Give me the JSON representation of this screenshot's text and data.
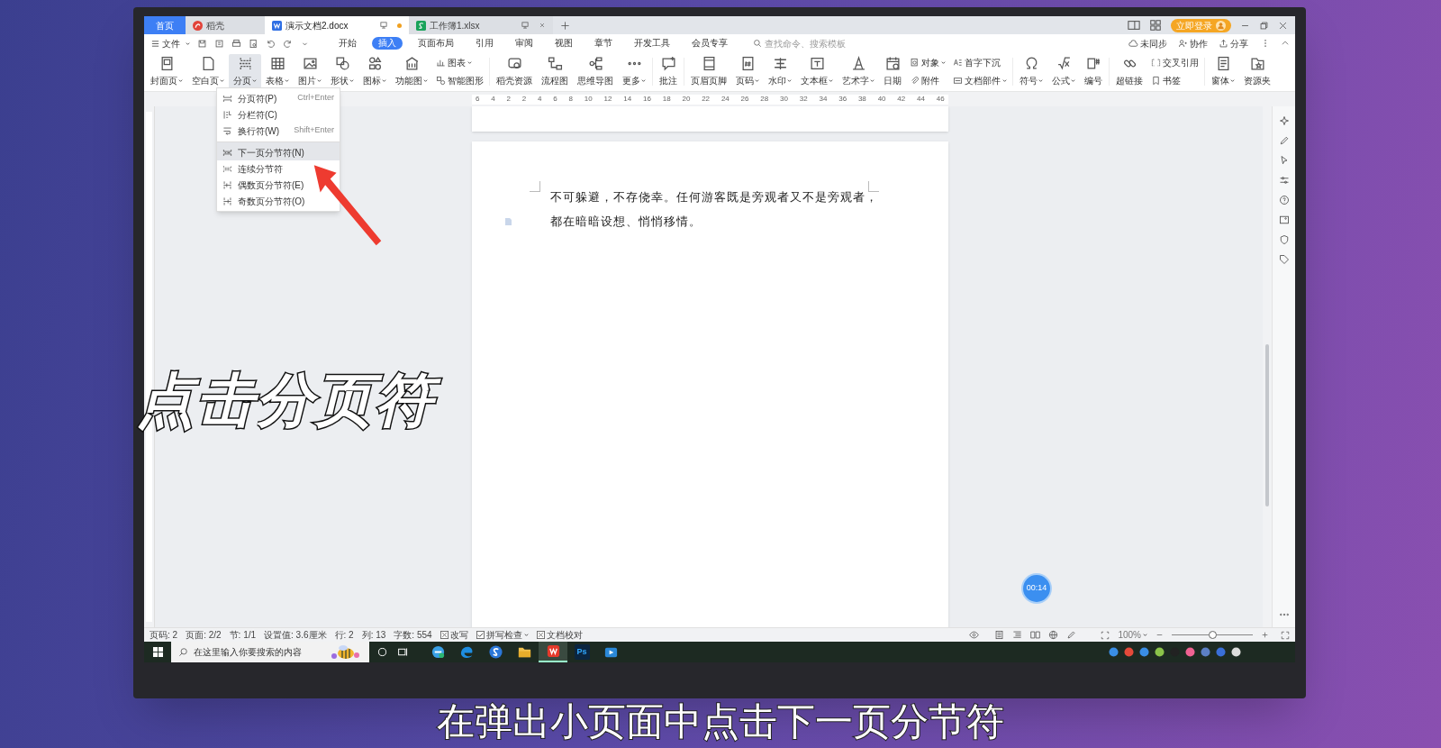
{
  "tabs": [
    {
      "label": "首页",
      "kind": "home",
      "selected": false
    },
    {
      "label": "稻壳",
      "kind": "daoke",
      "selected": false
    },
    {
      "label": "演示文档2.docx",
      "kind": "doc",
      "selected": true
    },
    {
      "label": "工作簿1.xlsx",
      "kind": "sheet",
      "selected": false
    }
  ],
  "login": "立即登录",
  "menu": {
    "file": "文件",
    "tabs": [
      {
        "label": "开始",
        "selected": false
      },
      {
        "label": "插入",
        "selected": true
      },
      {
        "label": "页面布局",
        "selected": false
      },
      {
        "label": "引用",
        "selected": false
      },
      {
        "label": "审阅",
        "selected": false
      },
      {
        "label": "视图",
        "selected": false
      },
      {
        "label": "章节",
        "selected": false
      },
      {
        "label": "开发工具",
        "selected": false
      },
      {
        "label": "会员专享",
        "selected": false
      }
    ],
    "search": {
      "placeholder": "查找命令、搜索模板"
    },
    "right": [
      "未同步",
      "协作",
      "分享"
    ]
  },
  "ribbon": [
    {
      "kind": "big",
      "label": "封面页",
      "dropdown": true,
      "selected": false
    },
    {
      "kind": "big",
      "label": "空白页",
      "dropdown": true,
      "selected": false
    },
    {
      "kind": "big",
      "label": "分页",
      "dropdown": true,
      "selected": true
    },
    {
      "kind": "big",
      "label": "表格",
      "dropdown": true,
      "selected": false
    },
    {
      "kind": "big",
      "label": "图片",
      "dropdown": true,
      "selected": false
    },
    {
      "kind": "big",
      "label": "形状",
      "dropdown": true,
      "selected": false
    },
    {
      "kind": "big",
      "label": "图标",
      "dropdown": true,
      "selected": false
    },
    {
      "kind": "big",
      "label": "功能图",
      "dropdown": true,
      "selected": false
    },
    {
      "kind": "pair",
      "items": [
        {
          "label": "图表",
          "dropdown": true
        },
        {
          "label": "智能图形",
          "dropdown": false
        }
      ]
    },
    {
      "kind": "big",
      "label": "稻壳资源",
      "dropdown": false,
      "selected": false
    },
    {
      "kind": "big",
      "label": "流程图",
      "dropdown": false,
      "selected": false
    },
    {
      "kind": "big",
      "label": "思维导图",
      "dropdown": false,
      "selected": false
    },
    {
      "kind": "big",
      "label": "更多",
      "dropdown": true,
      "selected": false
    },
    {
      "kind": "big",
      "label": "批注",
      "dropdown": false,
      "selected": false
    },
    {
      "kind": "big",
      "label": "页眉页脚",
      "dropdown": false,
      "selected": false
    },
    {
      "kind": "big",
      "label": "页码",
      "dropdown": true,
      "selected": false
    },
    {
      "kind": "big",
      "label": "水印",
      "dropdown": true,
      "selected": false
    },
    {
      "kind": "big",
      "label": "文本框",
      "dropdown": true,
      "selected": false
    },
    {
      "kind": "big",
      "label": "艺术字",
      "dropdown": true,
      "selected": false
    },
    {
      "kind": "big",
      "label": "日期",
      "dropdown": false,
      "selected": false
    },
    {
      "kind": "pair",
      "items": [
        {
          "label": "对象",
          "dropdown": true
        },
        {
          "label": "附件",
          "dropdown": false
        }
      ]
    },
    {
      "kind": "pair",
      "items": [
        {
          "label": "首字下沉",
          "dropdown": false
        },
        {
          "label": "文档部件",
          "dropdown": true
        }
      ]
    },
    {
      "kind": "big",
      "label": "符号",
      "dropdown": true,
      "selected": false
    },
    {
      "kind": "big",
      "label": "公式",
      "dropdown": true,
      "selected": false
    },
    {
      "kind": "big",
      "label": "编号",
      "dropdown": false,
      "selected": false
    },
    {
      "kind": "big",
      "label": "超链接",
      "dropdown": false,
      "selected": false
    },
    {
      "kind": "pair",
      "items": [
        {
          "label": "交叉引用",
          "dropdown": false
        },
        {
          "label": "书签",
          "dropdown": false
        }
      ]
    },
    {
      "kind": "big",
      "label": "窗体",
      "dropdown": true,
      "selected": false
    },
    {
      "kind": "big",
      "label": "资源夹",
      "dropdown": false,
      "selected": false
    }
  ],
  "break_menu": [
    {
      "label": "分页符(P)",
      "shortcut": "Ctrl+Enter",
      "selected": false,
      "separator_before": false
    },
    {
      "label": "分栏符(C)",
      "selected": false,
      "separator_before": false
    },
    {
      "label": "换行符(W)",
      "shortcut": "Shift+Enter",
      "selected": false,
      "separator_before": false
    },
    {
      "label": "下一页分节符(N)",
      "selected": true,
      "separator_before": true
    },
    {
      "label": "连续分节符",
      "selected": false,
      "separator_before": false
    },
    {
      "label": "偶数页分节符(E)",
      "selected": false,
      "separator_before": false
    },
    {
      "label": "奇数页分节符(O)",
      "selected": false,
      "separator_before": false
    }
  ],
  "ruler": [
    "6",
    "4",
    "2",
    "2",
    "4",
    "6",
    "8",
    "10",
    "12",
    "14",
    "16",
    "18",
    "20",
    "22",
    "24",
    "26",
    "28",
    "30",
    "32",
    "34",
    "36",
    "38",
    "40",
    "42",
    "44",
    "46"
  ],
  "document": {
    "paragraph": [
      "不可躲避，不存侥幸。任何游客既是旁观者又不是旁观者，",
      "都在暗暗设想、悄悄移情。"
    ]
  },
  "timer": "00:14",
  "status_bar": {
    "fields": [
      "页码: 2",
      "页面: 2/2",
      "节: 1/1",
      "设置值: 3.6厘米",
      "行: 2",
      "列: 13",
      "字数: 554"
    ],
    "toggles": [
      {
        "label": "改写",
        "checked": false,
        "dropdown": false
      },
      {
        "label": "拼写检查",
        "checked": true,
        "dropdown": true
      },
      {
        "label": "文档校对",
        "checked": false,
        "dropdown": false
      }
    ],
    "zoom": "100%",
    "zoom_slider": {
      "level": 0.5
    }
  },
  "taskbar": {
    "search": {
      "placeholder": "在这里输入你要搜索的内容"
    },
    "apps": [
      {
        "kind": "edge-old",
        "selected": false
      },
      {
        "kind": "edge",
        "selected": false
      },
      {
        "kind": "sogou",
        "selected": false
      },
      {
        "kind": "folder",
        "selected": false
      },
      {
        "kind": "wps",
        "selected": true
      },
      {
        "kind": "ps",
        "label": "Ps",
        "selected": false
      },
      {
        "kind": "video",
        "selected": false
      }
    ]
  },
  "captions": {
    "side": "点击分页符",
    "bottom": "在弹出小页面中点击下一页分节符"
  }
}
